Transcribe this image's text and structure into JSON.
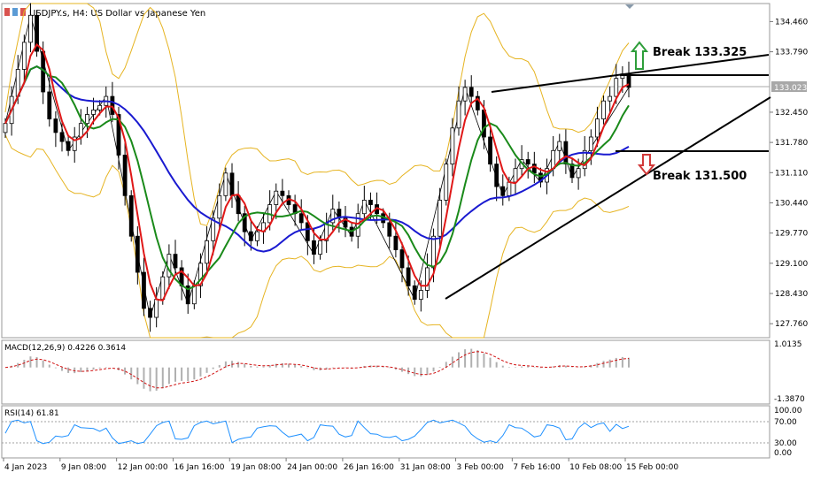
{
  "header": {
    "symbol": "USDJPY.s",
    "timeframe": "H4",
    "description": "US Dollar vs Japanese Yen",
    "title_text": "USDJPY.s, H4:  US Dollar vs Japanese Yen"
  },
  "annotations": {
    "break_up": "Break 133.325",
    "break_down": "Break 131.500",
    "up_color": "#2e9e3a",
    "down_color": "#d23a3a"
  },
  "chart_data": [
    {
      "type": "candlestick",
      "panel": "price",
      "title": "USDJPY.s, H4:  US Dollar vs Japanese Yen",
      "ylim": [
        127.45,
        134.86
      ],
      "y_ticks": [
        "134.460",
        "133.790",
        "132.450",
        "131.780",
        "131.110",
        "130.440",
        "129.770",
        "129.100",
        "128.430",
        "127.760"
      ],
      "current_price": "133.023",
      "x_ticks": [
        "4 Jan 2023",
        "9 Jan 08:00",
        "12 Jan 00:00",
        "16 Jan 16:00",
        "19 Jan 08:00",
        "24 Jan 00:00",
        "26 Jan 16:00",
        "31 Jan 08:00",
        "3 Feb 00:00",
        "7 Feb 16:00",
        "10 Feb 08:00",
        "15 Feb 00:00"
      ],
      "closes": [
        132.2,
        132.8,
        133.4,
        134.0,
        134.6,
        133.8,
        132.9,
        132.3,
        132.0,
        131.8,
        131.6,
        131.9,
        132.2,
        132.4,
        132.5,
        132.6,
        132.8,
        132.4,
        131.5,
        130.6,
        129.7,
        128.9,
        128.1,
        127.9,
        128.3,
        128.8,
        129.3,
        129.0,
        128.6,
        128.2,
        128.6,
        129.1,
        129.6,
        130.1,
        130.6,
        131.1,
        130.6,
        130.2,
        129.8,
        129.6,
        129.8,
        130.0,
        130.4,
        130.7,
        130.6,
        130.4,
        130.2,
        130.0,
        129.6,
        129.3,
        129.6,
        130.0,
        130.3,
        130.1,
        129.9,
        129.7,
        130.2,
        130.5,
        130.4,
        130.2,
        130.0,
        129.7,
        129.4,
        129.0,
        128.6,
        128.3,
        128.5,
        129.0,
        129.7,
        130.5,
        131.3,
        132.1,
        132.7,
        133.0,
        132.8,
        132.5,
        131.9,
        131.3,
        130.8,
        130.6,
        130.9,
        131.2,
        131.4,
        131.3,
        131.1,
        130.9,
        131.2,
        131.6,
        131.8,
        131.3,
        131.0,
        131.2,
        131.6,
        131.9,
        132.3,
        132.7,
        132.8,
        133.2,
        133.3,
        133.0
      ],
      "ma_red_end": 132.0,
      "ma_green_end": 131.5,
      "ma_blue_end": 131.1,
      "rising_wedge": {
        "upper": {
          "from": {
            "date": "2 Feb",
            "price": 133.0
          },
          "to": {
            "date": "15 Feb",
            "price": 133.8
          }
        },
        "lower": {
          "from": {
            "date": "1 Feb",
            "price": 128.0
          },
          "to": {
            "date": "15 Feb",
            "price": 132.7
          }
        }
      },
      "horizontal_levels": [
        133.325,
        131.5
      ],
      "legend": "none",
      "grid": false
    },
    {
      "type": "histogram",
      "panel": "macd",
      "label": "MACD(12,26,9) 0.4226 0.3614",
      "y_ticks": [
        "1.0135",
        "-1.3870"
      ],
      "ylim": [
        -1.387,
        1.0135
      ],
      "macd_last": 0.4226,
      "signal_last": 0.3614
    },
    {
      "type": "line",
      "panel": "rsi",
      "label": "RSI(14) 61.81",
      "y_ticks": [
        "100.00",
        "70.00",
        "30.00",
        "0.00"
      ],
      "levels": [
        70,
        30
      ],
      "ylim": [
        0,
        100
      ],
      "rsi_last": 61.81
    }
  ]
}
